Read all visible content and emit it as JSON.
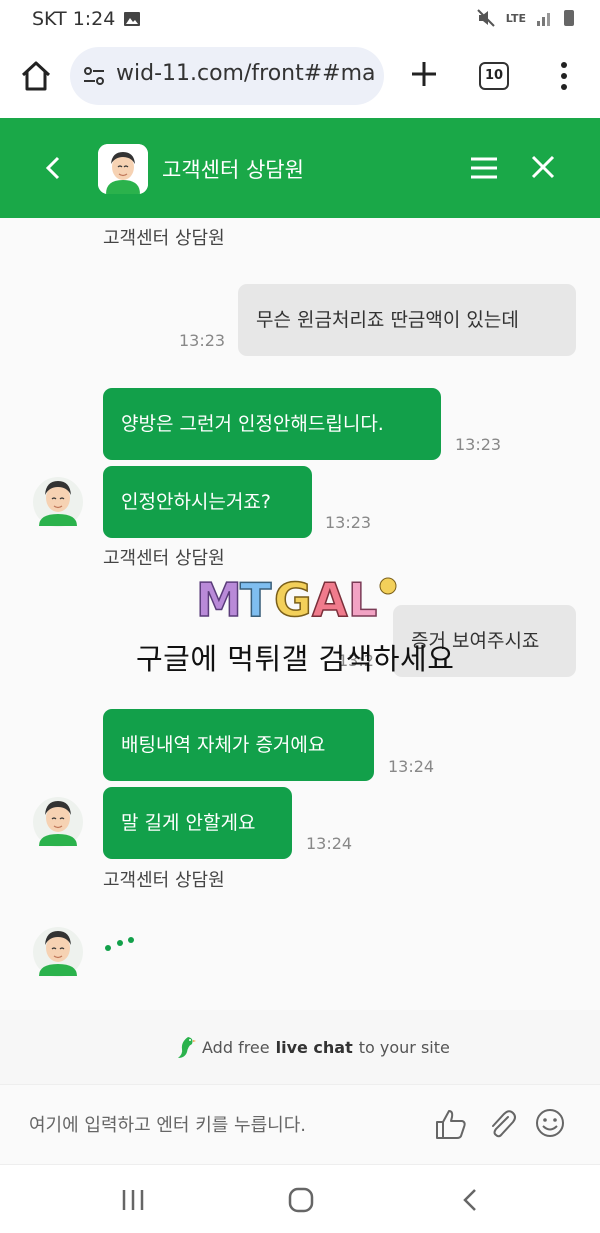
{
  "status_bar": {
    "carrier_time": "SKT 1:24",
    "network": "LTE"
  },
  "browser": {
    "url": "wid-11.com/front##ma",
    "tab_count": "10"
  },
  "chat_header": {
    "title": "고객센터 상담원"
  },
  "messages": {
    "sender_top": "고객센터 상담원",
    "user_1": {
      "text": "무슨 윈금처리죠 딴금액이 있는데",
      "time": "13:23"
    },
    "agent_1": {
      "text": "양방은 그런거 인정안해드립니다.",
      "time": "13:23"
    },
    "agent_2": {
      "text": "인정안하시는거죠?",
      "time": "13:23"
    },
    "sender_2": "고객센터 상담원",
    "user_2": {
      "text": "증거 보여주시죠",
      "time": "13:2"
    },
    "agent_3": {
      "text": "배팅내역 자체가 증거에요",
      "time": "13:24"
    },
    "agent_4": {
      "text": "말 길게 안할게요",
      "time": "13:24"
    },
    "sender_3": "고객센터 상담원"
  },
  "watermark": {
    "logo": "MTGAL",
    "text": "구글에 먹튀갤 검색하세요"
  },
  "powered_by": {
    "prefix": "Add free",
    "bold": "live chat",
    "suffix": "to your site"
  },
  "input": {
    "placeholder": "여기에 입력하고 엔터 키를 누릅니다."
  },
  "colors": {
    "brand_green": "#1aa848",
    "bubble_green": "#12a04a",
    "user_bubble": "#e7e7e7"
  }
}
